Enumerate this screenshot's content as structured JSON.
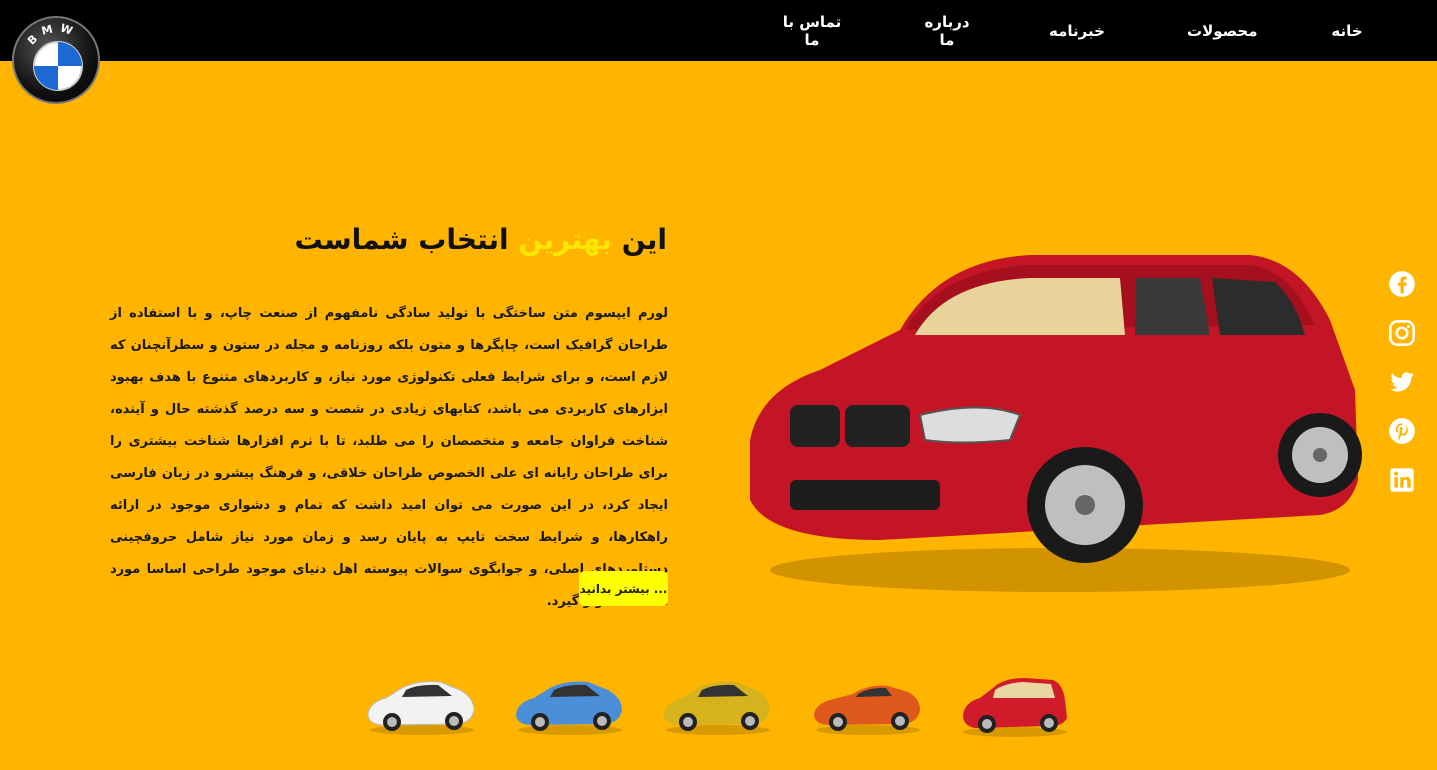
{
  "nav": {
    "items": [
      {
        "label": "خانه"
      },
      {
        "label": "محصولات"
      },
      {
        "label": "خبرنامه"
      },
      {
        "label": "درباره ما"
      },
      {
        "label": "تماس با ما"
      }
    ]
  },
  "brand": {
    "logo_text": "BMW"
  },
  "hero": {
    "title_start": "این",
    "title_highlight": "بهترین",
    "title_end": "انتخاب شماست",
    "paragraph": "لورم ایپسوم متن ساختگی با تولید سادگی نامفهوم از صنعت چاپ، و با استفاده از طراحان گرافیک است، چاپگرها و متون بلکه روزنامه و مجله در ستون و سطرآنچنان که لازم است، و برای شرایط فعلی تکنولوژی مورد نیاز، و کاربردهای متنوع با هدف بهبود ابزارهای کاربردی می باشد، کتابهای زیادی در شصت و سه درصد گذشته حال و آینده، شناخت فراوان جامعه و متخصصان را می طلبد، تا با نرم افزارها شناخت بیشتری را برای طراحان رایانه ای علی الخصوص طراحان خلاقی، و فرهنگ پیشرو در زبان فارسی ایجاد کرد، در این صورت می توان امید داشت که تمام و دشواری موجود در ارائه راهکارها، و شرایط سخت تایپ به پایان رسد و زمان مورد نیاز شامل حروفچینی دستاوردهای اصلی، و جوابگوی سوالات پیوسته اهل دنیای موجود طراحی اساسا مورد استفاده قرار گیرد.",
    "button_label": "بیشتر بدانید ..."
  },
  "social": [
    "facebook-icon",
    "instagram-icon",
    "twitter-icon",
    "pinterest-icon",
    "linkedin-icon"
  ],
  "thumbnails": [
    {
      "color": "#d01c2a"
    },
    {
      "color": "#e0591c"
    },
    {
      "color": "#d6b21c"
    },
    {
      "color": "#4a8fd8"
    },
    {
      "color": "#f2f2f2"
    }
  ],
  "colors": {
    "background": "#ffb400",
    "header": "#000000",
    "highlight": "#ffe600",
    "button": "#ffff00",
    "main_car": "#c41526"
  }
}
